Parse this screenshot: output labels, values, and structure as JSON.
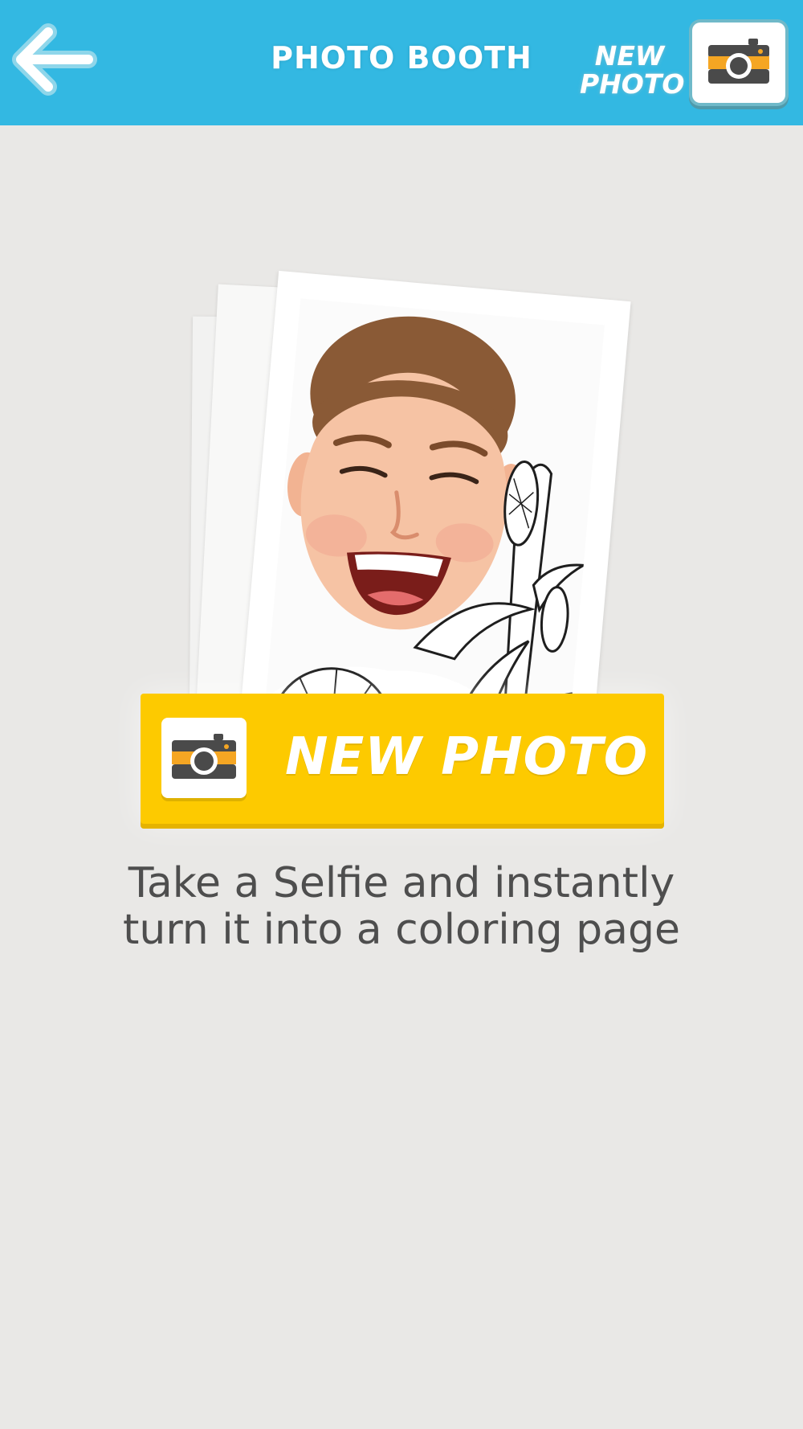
{
  "header": {
    "title": "PHOTO BOOTH",
    "new_photo_line1": "NEW",
    "new_photo_line2": "PHOTO",
    "back_icon": "arrow-left-icon",
    "camera_icon": "camera-icon"
  },
  "main": {
    "new_photo_button_label": "NEW PHOTO",
    "description_line1": "Take a Selfie and instantly",
    "description_line2": "turn it into a coloring page"
  },
  "colors": {
    "header_bg": "#33b8e2",
    "page_bg": "#e9e8e6",
    "button_yellow": "#fdca00",
    "camera_orange": "#f5a623",
    "camera_dark": "#4a4a4a"
  }
}
